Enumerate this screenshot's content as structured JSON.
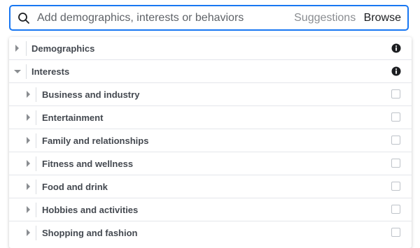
{
  "search": {
    "placeholder": "Add demographics, interests or behaviors",
    "value": "",
    "suggestions_label": "Suggestions",
    "browse_label": "Browse"
  },
  "categories": [
    {
      "label": "Demographics",
      "expanded": false,
      "icon": "info-icon"
    },
    {
      "label": "Interests",
      "expanded": true,
      "icon": "info-icon"
    }
  ],
  "interests": [
    {
      "label": "Business and industry",
      "checked": false
    },
    {
      "label": "Entertainment",
      "checked": false
    },
    {
      "label": "Family and relationships",
      "checked": false
    },
    {
      "label": "Fitness and wellness",
      "checked": false
    },
    {
      "label": "Food and drink",
      "checked": false
    },
    {
      "label": "Hobbies and activities",
      "checked": false
    },
    {
      "label": "Shopping and fashion",
      "checked": false
    }
  ],
  "colors": {
    "accent": "#1877f2",
    "text": "#444950",
    "muted": "#8a8d91"
  }
}
